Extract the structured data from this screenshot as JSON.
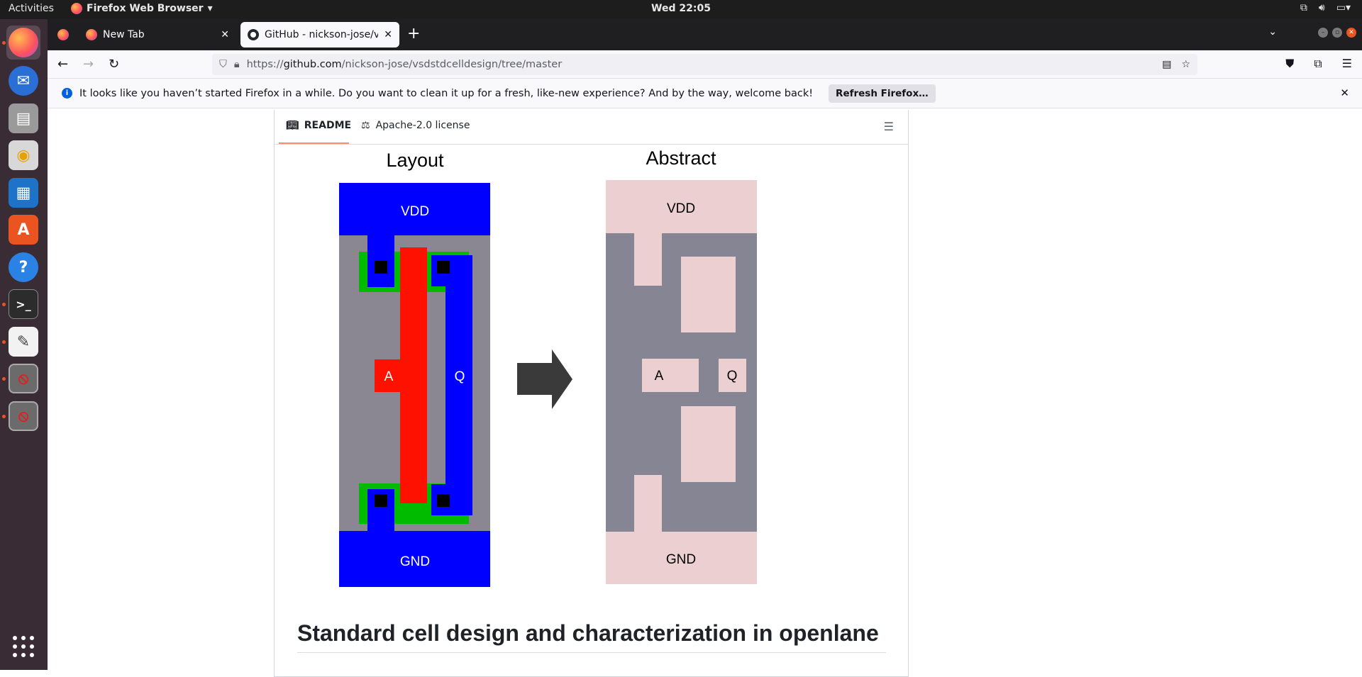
{
  "topbar": {
    "activities": "Activities",
    "app_menu": "Firefox Web Browser",
    "clock": "Wed 22:05"
  },
  "dock": {
    "items": [
      "firefox-icon",
      "thunderbird-icon",
      "files-icon",
      "rhythmbox-icon",
      "writer-icon",
      "software-icon",
      "help-icon",
      "terminal-icon",
      "text-editor-icon",
      "blocked-app-icon",
      "blocked-app-icon"
    ],
    "accent_color": "#e95420"
  },
  "browser": {
    "tabs": [
      {
        "label": "New Tab"
      },
      {
        "label": "GitHub - nickson-jose/vsc"
      }
    ],
    "url_prefix": "https://",
    "url_domain": "github.com",
    "url_path": "/nickson-jose/vsdstdcelldesign/tree/master"
  },
  "notification": {
    "message": "It looks like you haven’t started Firefox in a while. Do you want to clean it up for a fresh, like-new experience? And by the way, welcome back!",
    "button": "Refresh Firefox…"
  },
  "readme": {
    "tabs": [
      {
        "label": "README"
      },
      {
        "label": "Apache-2.0 license"
      }
    ],
    "figure": {
      "layout_title": "Layout",
      "abstract_title": "Abstract",
      "vdd": "VDD",
      "gnd": "GND",
      "pin_a": "A",
      "pin_q": "Q",
      "colors": {
        "metal": "#0000ff",
        "poly": "#ff1100",
        "diffusion": "#00bb00",
        "substrate": "#8a8793",
        "abstract_block": "#ecd0d1",
        "abstract_bg": "#868593"
      }
    },
    "heading": "Standard cell design and characterization in openlane"
  }
}
